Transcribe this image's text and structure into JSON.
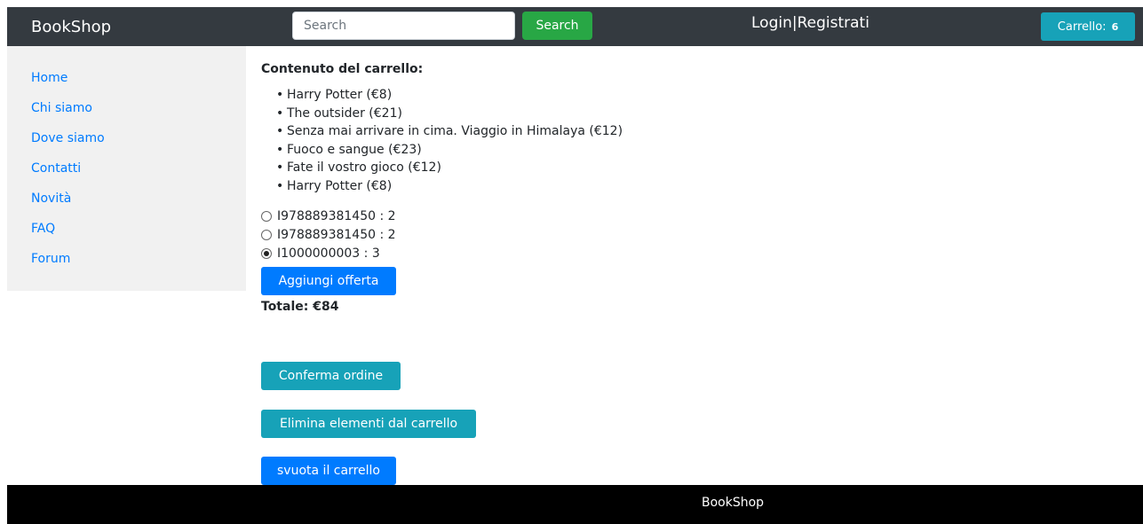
{
  "navbar": {
    "brand": "BookShop",
    "search_placeholder": "Search",
    "search_button": "Search",
    "login": "Login",
    "separator": "|",
    "register": "Registrati",
    "cart_label": "Carrello:",
    "cart_count": "6"
  },
  "sidebar": {
    "items": [
      {
        "label": "Home"
      },
      {
        "label": "Chi siamo"
      },
      {
        "label": "Dove siamo"
      },
      {
        "label": "Contatti"
      },
      {
        "label": "Novità"
      },
      {
        "label": "FAQ"
      },
      {
        "label": "Forum"
      }
    ]
  },
  "main": {
    "title": "Contenuto del carrello:",
    "items": [
      "Harry Potter (€8)",
      "The outsider (€21)",
      "Senza mai arrivare in cima. Viaggio in Himalaya (€12)",
      "Fuoco e sangue (€23)",
      "Fate il vostro gioco (€12)",
      "Harry Potter (€8)"
    ],
    "offers": [
      {
        "label": "I978889381450 : 2",
        "selected": false
      },
      {
        "label": "I978889381450 : 2",
        "selected": false
      },
      {
        "label": "I1000000003 : 3",
        "selected": true
      }
    ],
    "add_offer_button": "Aggiungi offerta",
    "total": "Totale: €84",
    "confirm_button": "Conferma ordine",
    "remove_button": "Elimina elementi dal carrello",
    "empty_button": "svuota il carrello"
  },
  "footer": {
    "text": "BookShop"
  },
  "colors": {
    "navbar_bg": "#343a40",
    "sidebar_bg": "#f1f1f1",
    "link": "#007bff",
    "success": "#28a745",
    "info": "#17a2b8",
    "primary": "#007bff",
    "footer_bg": "#000000"
  }
}
